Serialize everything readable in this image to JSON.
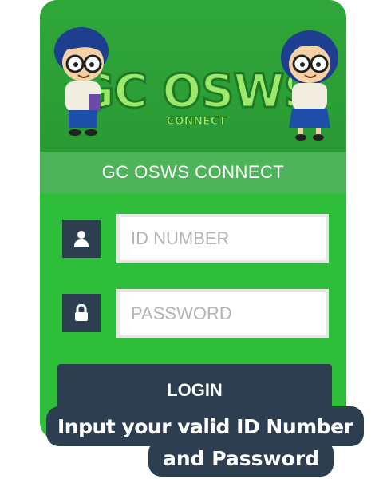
{
  "app": {
    "logo_text": "GC OSWS",
    "logo_subtext": "CONNECT",
    "title": "GC OSWS CONNECT"
  },
  "form": {
    "id_placeholder": "ID NUMBER",
    "password_placeholder": "PASSWORD",
    "login_label": "LOGIN"
  },
  "caption": {
    "line1": "Input your valid ID Number",
    "line2": "and Password"
  },
  "icons": {
    "user": "user-icon",
    "lock": "lock-icon"
  },
  "colors": {
    "card_green": "#2fbe39",
    "banner_green": "#2a9a34",
    "header_green": "#4eb35a",
    "navy": "#2c3e50"
  }
}
